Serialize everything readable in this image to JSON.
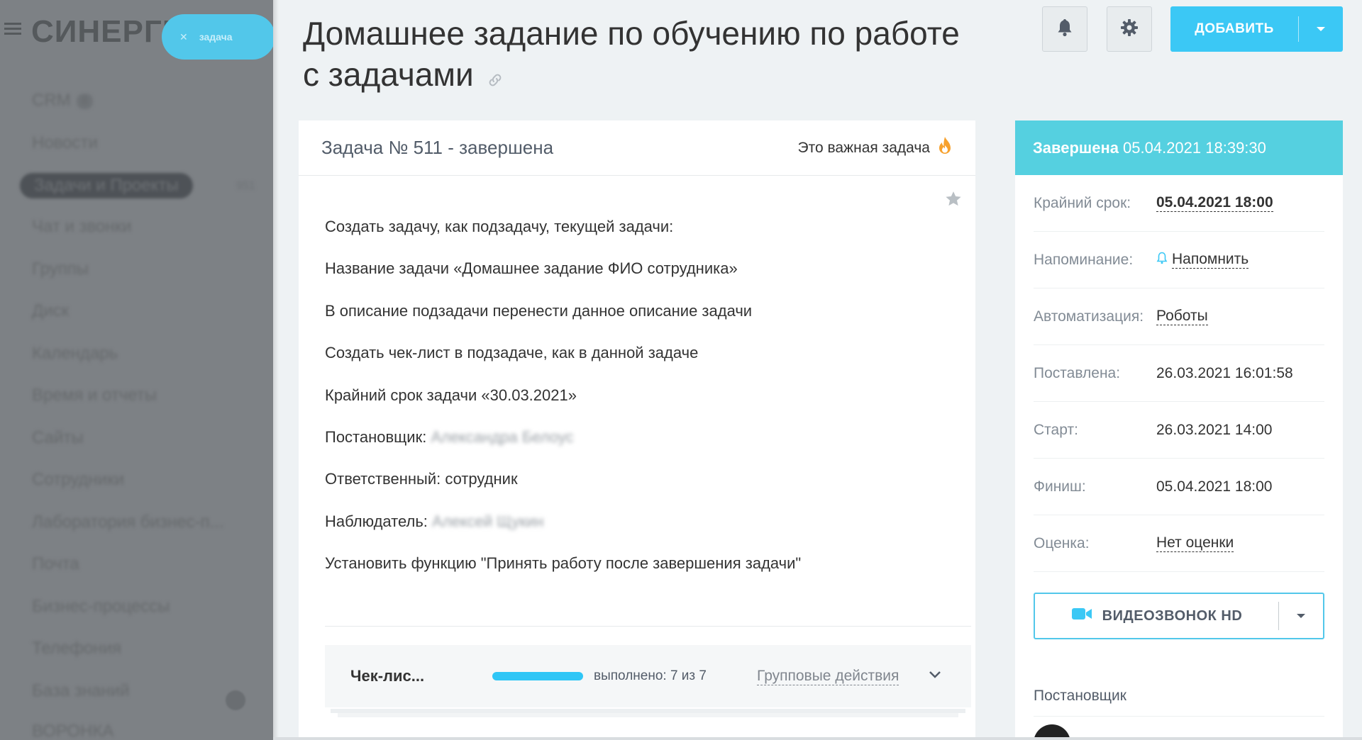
{
  "sidebar": {
    "logo": "СИНЕРГИ",
    "task_pill": "задача",
    "items": [
      {
        "label": "CRM",
        "badge": "8"
      },
      {
        "label": "Новости"
      },
      {
        "label": "Задачи и Проекты",
        "badge": "951"
      },
      {
        "label": "Чат и звонки"
      },
      {
        "label": "Группы"
      },
      {
        "label": "Диск"
      },
      {
        "label": "Календарь"
      },
      {
        "label": "Время и отчеты"
      },
      {
        "label": "Сайты"
      },
      {
        "label": "Сотрудники"
      },
      {
        "label": "Лаборатория бизнес-п..."
      },
      {
        "label": "Почта"
      },
      {
        "label": "Бизнес-процессы"
      },
      {
        "label": "Телефония"
      },
      {
        "label": "База знаний"
      },
      {
        "label": "ВОРОНКА"
      }
    ]
  },
  "header": {
    "title": "Домашнее задание по обучению по работе с задачами",
    "add_label": "ДОБАВИТЬ"
  },
  "task": {
    "status_line": "Задача № 511 - завершена",
    "important_label": "Это важная задача",
    "description": [
      {
        "text": "Создать задачу, как подзадачу, текущей задачи:"
      },
      {
        "text": "Название задачи «Домашнее задание ФИО сотрудника»"
      },
      {
        "text": "В описание подзадачи перенести данное описание задачи"
      },
      {
        "text": "Создать чек-лист в подзадаче, как в данной задаче"
      },
      {
        "text": "Крайний срок задачи «30.03.2021»"
      },
      {
        "text": "Постановщик: ",
        "hidden": "Александра Белоус"
      },
      {
        "text": "Ответственный: сотрудник"
      },
      {
        "text": "Наблюдатель: ",
        "hidden": "Алексей Щукин"
      },
      {
        "text": "Установить функцию \"Принять работу после завершения задачи\""
      }
    ],
    "checklist": {
      "title": "Чек-лис...",
      "progress_fraction": 1.0,
      "done_label": "выполнено: 7 из 7",
      "group_actions": "Групповые действия"
    }
  },
  "side": {
    "status_word": "Завершена",
    "status_date": "05.04.2021 18:39:30",
    "props": [
      {
        "key": "Крайний срок:",
        "value": "05.04.2021 18:00"
      },
      {
        "key": "Напоминание:",
        "value": "Напомнить"
      },
      {
        "key": "Автоматизация:",
        "value": "Роботы"
      },
      {
        "key": "Поставлена:",
        "value": "26.03.2021 16:01:58"
      },
      {
        "key": "Старт:",
        "value": "26.03.2021 14:00"
      },
      {
        "key": "Финиш:",
        "value": "05.04.2021 18:00"
      },
      {
        "key": "Оценка:",
        "value": "Нет оценки"
      }
    ],
    "video_label": "ВИДЕОЗВОНОК HD",
    "creator_label": "Постановщик"
  },
  "colors": {
    "accent": "#3bc8f5",
    "status_bar": "#55d0e0",
    "sidebar_dim": "#7d8185"
  }
}
